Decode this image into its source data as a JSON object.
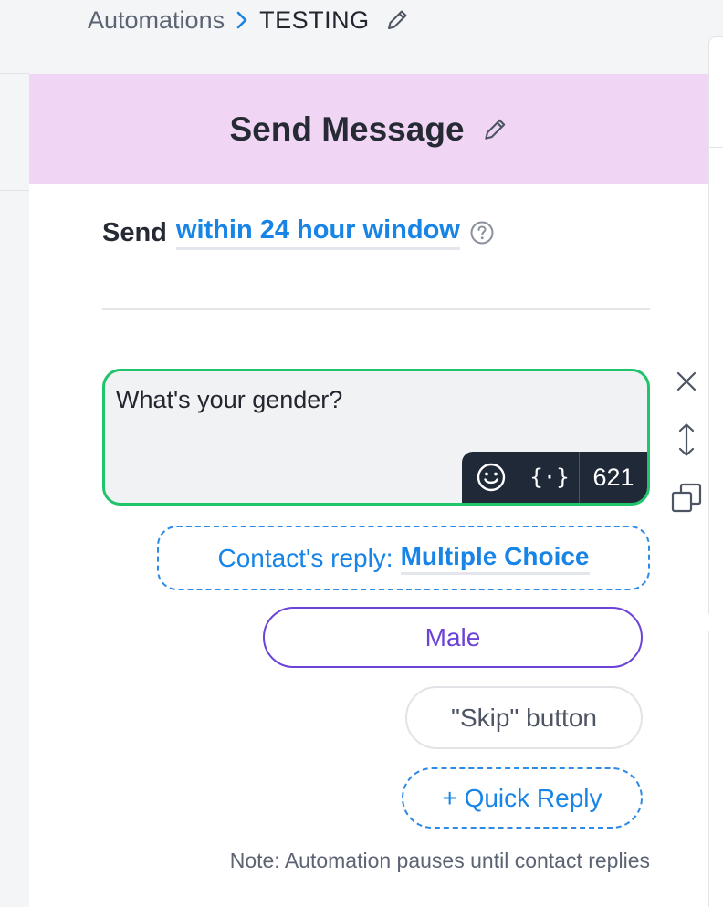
{
  "breadcrumb": {
    "root": "Automations",
    "current": "TESTING"
  },
  "card": {
    "title": "Send Message",
    "send_label": "Send",
    "send_window": "within 24 hour window",
    "message": {
      "text": "What's your gender?",
      "variables_label": "{·}",
      "char_count": "621"
    },
    "reply_type": {
      "prefix": "Contact's reply:",
      "value": "Multiple Choice"
    },
    "choices": [
      "Male"
    ],
    "skip_button": "\"Skip\" button",
    "quick_reply": "+ Quick Reply",
    "note": "Note: Automation pauses until contact replies"
  },
  "colors": {
    "header_bg": "#f0d6f4",
    "accent_blue": "#1784e6",
    "choice_purple": "#6b43d6",
    "message_border": "#20c46b",
    "toolbar_bg": "#1f2937"
  },
  "icons": [
    "chevron-right-icon",
    "pencil-icon",
    "help-circle-icon",
    "emoji-icon",
    "close-icon",
    "resize-vertical-icon",
    "duplicate-icon"
  ]
}
